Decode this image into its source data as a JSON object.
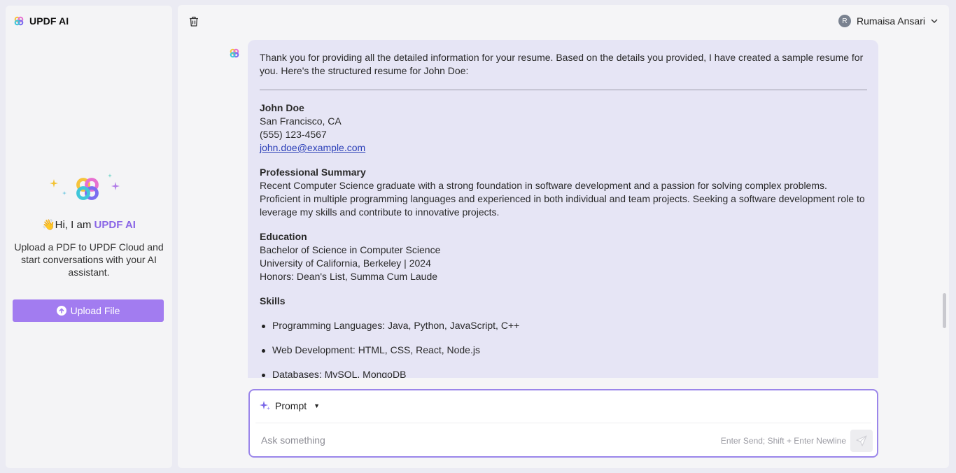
{
  "sidebar": {
    "brand": "UPDF AI",
    "greeting_prefix": "👋Hi, I am",
    "greeting_brand": "UPDF AI",
    "description": "Upload a PDF to UPDF Cloud and start conversations with your AI assistant.",
    "upload_button": "Upload File"
  },
  "header": {
    "user_initial": "R",
    "user_name": "Rumaisa Ansari"
  },
  "message": {
    "intro": "Thank you for providing all the detailed information for your resume. Based on the details you provided, I have created a sample resume for you. Here's the structured resume for John Doe:",
    "contact": {
      "name": "John Doe",
      "location": "San Francisco, CA",
      "phone": "(555) 123-4567",
      "email": "john.doe@example.com"
    },
    "summary": {
      "heading": "Professional Summary",
      "text": "Recent Computer Science graduate with a strong foundation in software development and a passion for solving complex problems. Proficient in multiple programming languages and experienced in both individual and team projects. Seeking a software development role to leverage my skills and contribute to innovative projects."
    },
    "education": {
      "heading": "Education",
      "lines": [
        "Bachelor of Science in Computer Science",
        "University of California, Berkeley | 2024",
        "Honors: Dean's List, Summa Cum Laude"
      ]
    },
    "skills": {
      "heading": "Skills",
      "items": [
        "Programming Languages: Java, Python, JavaScript, C++",
        "Web Development: HTML, CSS, React, Node.js",
        "Databases: MySQL, MongoDB"
      ]
    }
  },
  "composer": {
    "prompt_label": "Prompt",
    "placeholder": "Ask something",
    "hint": "Enter Send; Shift + Enter Newline"
  },
  "colors": {
    "accent": "#a27cf0",
    "bubble": "#e6e5f5",
    "composer_border": "#9b86ea"
  }
}
